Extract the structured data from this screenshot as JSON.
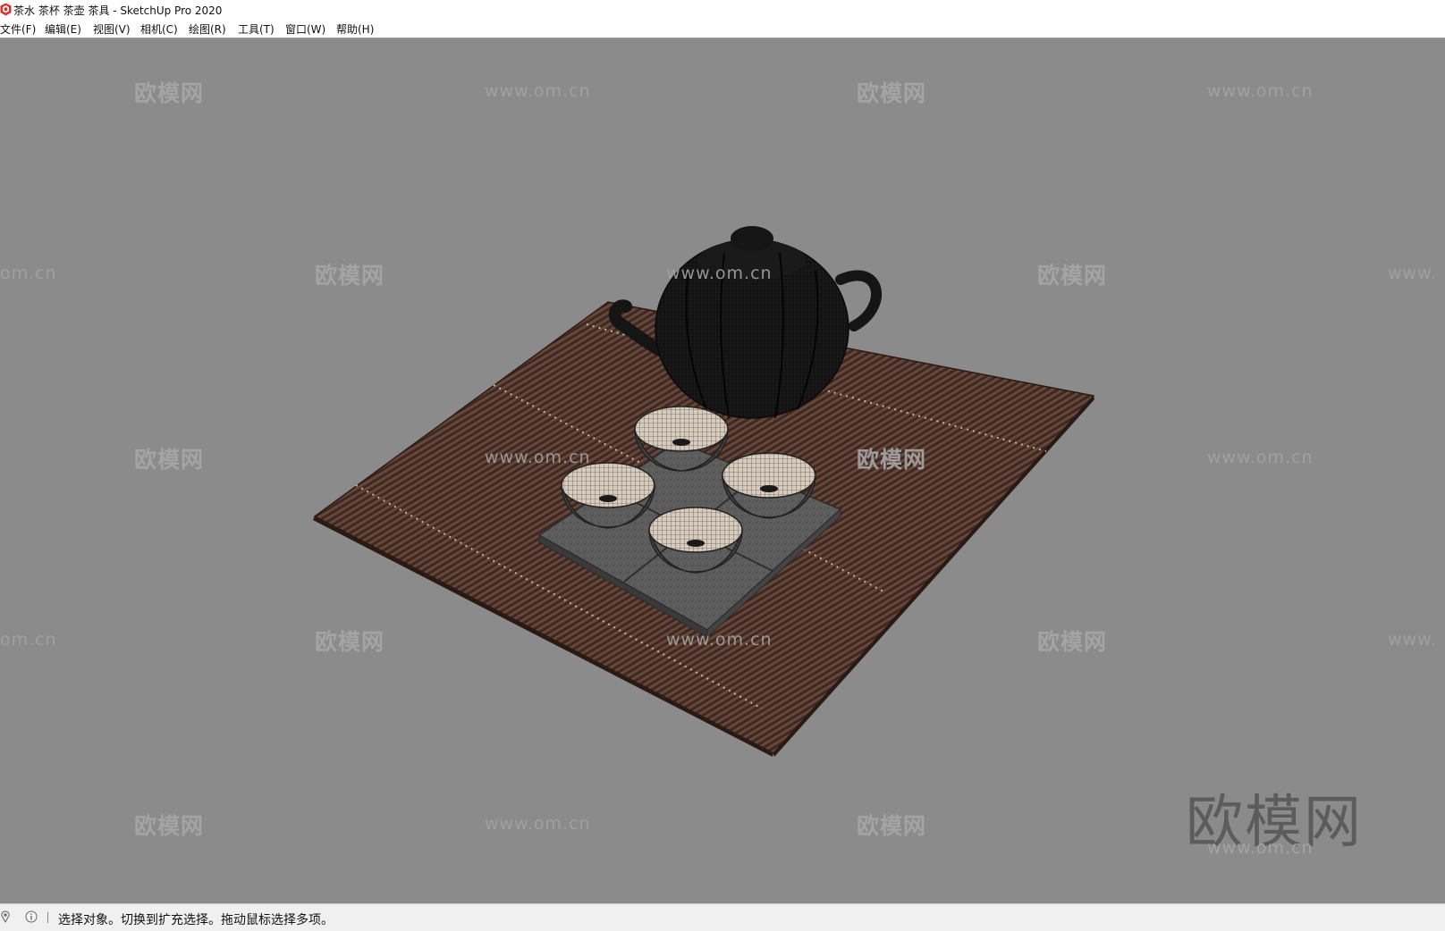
{
  "window": {
    "title": "茶水 茶杯 茶壶 茶具 - SketchUp Pro 2020",
    "app_icon": "sketchup-icon"
  },
  "menu": {
    "items": [
      {
        "label": "文件(F)"
      },
      {
        "label": "编辑(E)"
      },
      {
        "label": "视图(V)"
      },
      {
        "label": "相机(C)"
      },
      {
        "label": "绘图(R)"
      },
      {
        "label": "工具(T)"
      },
      {
        "label": "窗口(W)"
      },
      {
        "label": "帮助(H)"
      }
    ]
  },
  "viewport": {
    "background": "#8b8b8b",
    "model": {
      "objects": [
        "teapot",
        "bamboo-tea-mat",
        "tea-cup",
        "tea-cup",
        "tea-cup",
        "tea-cup",
        "coaster-tray"
      ]
    },
    "watermarks": {
      "brand": "欧模网",
      "url": "www.om.cn",
      "url_partial_left": "om.cn",
      "url_partial_right": "www."
    }
  },
  "statusbar": {
    "icons": [
      "geolocation-icon",
      "info-icon"
    ],
    "hint": "选择对象。切换到扩充选择。拖动鼠标选择多项。"
  },
  "colors": {
    "viewport_bg": "#8b8b8b",
    "mat": "#4a332c",
    "teapot": "#141414",
    "cup_inside": "#cfc2b3",
    "tray": "#5a5a5a"
  }
}
